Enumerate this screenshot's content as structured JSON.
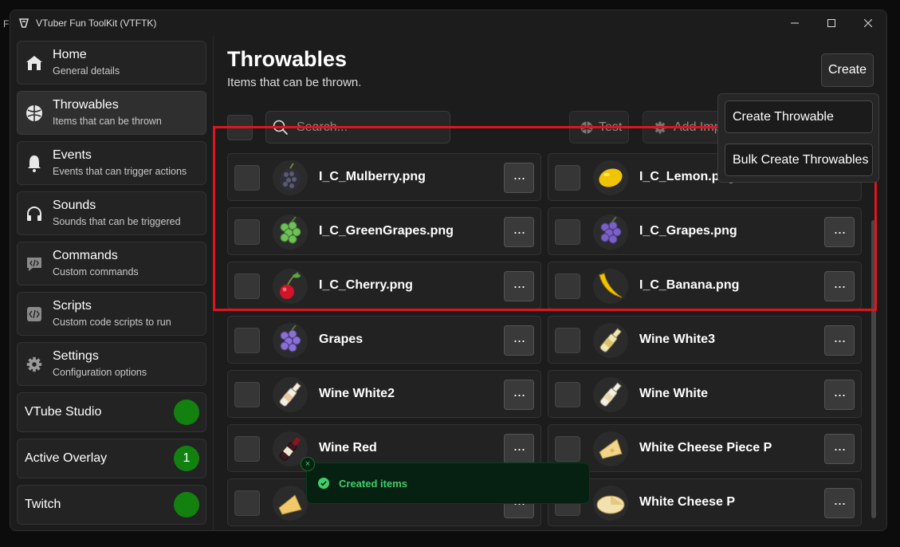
{
  "desktop_text": "F a",
  "window": {
    "title": "VTuber Fun ToolKit (VTFTK)"
  },
  "sidebar": {
    "nav": [
      {
        "title": "Home",
        "subtitle": "General details",
        "icon": "home-icon"
      },
      {
        "title": "Throwables",
        "subtitle": "Items that can be thrown",
        "icon": "ball-icon",
        "active": true
      },
      {
        "title": "Events",
        "subtitle": "Events that can trigger actions",
        "icon": "bell-icon"
      },
      {
        "title": "Sounds",
        "subtitle": "Sounds that can be triggered",
        "icon": "headphones-icon"
      },
      {
        "title": "Commands",
        "subtitle": "Custom commands",
        "icon": "code-bubble-icon"
      },
      {
        "title": "Scripts",
        "subtitle": "Custom code scripts to run",
        "icon": "code-file-icon"
      },
      {
        "title": "Settings",
        "subtitle": "Configuration options",
        "icon": "gear-icon"
      }
    ],
    "status": [
      {
        "label": "VTube Studio",
        "value": "",
        "color": "#12810f"
      },
      {
        "label": "Active Overlay",
        "value": "1",
        "color": "#12810f"
      },
      {
        "label": "Twitch",
        "value": "",
        "color": "#12810f"
      }
    ]
  },
  "main": {
    "title": "Throwables",
    "subtitle": "Items that can be thrown.",
    "create_label": "Create",
    "search_placeholder": "Search...",
    "test_label": "Test",
    "add_impact_label": "Add Imp",
    "items": [
      {
        "name": "I_C_Mulberry.png",
        "icon": "mulberry"
      },
      {
        "name": "I_C_Lemon.png",
        "icon": "lemon"
      },
      {
        "name": "I_C_GreenGrapes.png",
        "icon": "green-grapes"
      },
      {
        "name": "I_C_Grapes.png",
        "icon": "grapes"
      },
      {
        "name": "I_C_Cherry.png",
        "icon": "cherry"
      },
      {
        "name": "I_C_Banana.png",
        "icon": "banana"
      },
      {
        "name": "Grapes",
        "icon": "grapes"
      },
      {
        "name": "Wine White3",
        "icon": "wine-white"
      },
      {
        "name": "Wine White2",
        "icon": "wine-white"
      },
      {
        "name": "Wine White",
        "icon": "wine-white"
      },
      {
        "name": "Wine Red",
        "icon": "wine-red"
      },
      {
        "name": "White Cheese Piece P",
        "icon": "cheese"
      },
      {
        "name": "",
        "icon": "cheese"
      },
      {
        "name": "White Cheese P",
        "icon": "cheese-wheel"
      }
    ],
    "more_label": "···"
  },
  "dropdown": {
    "create_throwable": "Create Throwable",
    "bulk_create": "Bulk Create Throwables"
  },
  "toast": {
    "message": "Created items",
    "close": "×"
  },
  "colors": {
    "accent_green": "#12810f",
    "highlight_red": "#e0141c",
    "toast_text": "#3ccf6a"
  }
}
